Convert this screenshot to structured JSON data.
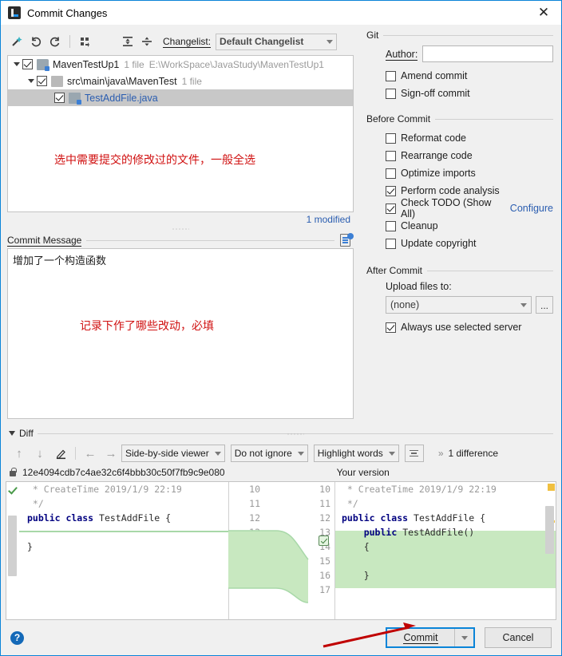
{
  "window": {
    "title": "Commit Changes",
    "icon": "intellij-idea-icon",
    "close_label": "✕"
  },
  "toolbar": {
    "icons": [
      "magic-wand-icon",
      "revert-icon",
      "refresh-icon",
      "group-by-icon",
      "expand-all-icon",
      "collapse-all-icon"
    ],
    "changelist_label": "Changelist:",
    "changelist_value": "Default Changelist"
  },
  "tree": {
    "nodes": [
      {
        "name": "MavenTestUp1",
        "files": "1 file",
        "path": "E:\\WorkSpace\\JavaStudy\\MavenTestUp1",
        "checked": true,
        "icon": "module-icon"
      },
      {
        "name": "src\\main\\java\\MavenTest",
        "files": "1 file",
        "path": "",
        "checked": true,
        "icon": "folder-icon"
      },
      {
        "name": "TestAddFile.java",
        "files": "",
        "path": "",
        "checked": true,
        "icon": "java-file-icon"
      }
    ],
    "annotation": "选中需要提交的修改过的文件，一般全选",
    "status": "1 modified"
  },
  "commit_message": {
    "label": "Commit Message",
    "value": "增加了一个构造函数",
    "annotation": "记录下作了哪些改动，必填",
    "toolbar_icon": "commit-history-icon"
  },
  "git": {
    "title": "Git",
    "author_label": "Author:",
    "author_value": "",
    "options": [
      {
        "label": "Amend commit",
        "checked": false
      },
      {
        "label": "Sign-off commit",
        "checked": false
      }
    ]
  },
  "before_commit": {
    "title": "Before Commit",
    "options": [
      {
        "label": "Reformat code",
        "checked": false
      },
      {
        "label": "Rearrange code",
        "checked": false
      },
      {
        "label": "Optimize imports",
        "checked": false
      },
      {
        "label": "Perform code analysis",
        "checked": true
      },
      {
        "label": "Check TODO (Show All)",
        "checked": true,
        "link": "Configure"
      },
      {
        "label": "Cleanup",
        "checked": false
      },
      {
        "label": "Update copyright",
        "checked": false
      }
    ]
  },
  "after_commit": {
    "title": "After Commit",
    "upload_label": "Upload files to:",
    "upload_value": "(none)",
    "browse_label": "...",
    "always_label": "Always use selected server",
    "always_checked": true
  },
  "diff": {
    "title": "Diff",
    "toolbar": {
      "prev_icon": "arrow-up-icon",
      "next_icon": "arrow-down-icon",
      "edit_icon": "pencil-icon",
      "left_icon": "arrow-left-icon",
      "right_icon": "arrow-right-icon",
      "viewer_mode": "Side-by-side viewer",
      "ignore_mode": "Do not ignore",
      "highlight_mode": "Highlight words",
      "collapse_icon": "collapse-unchanged-icon",
      "more_icon": "»",
      "difference_count": "1 difference"
    },
    "left_header": {
      "icon": "lock-icon",
      "revision": "12e4094cdb7c4ae32c6f4bbb30c50f7fb9c9e080"
    },
    "right_header": "Your version",
    "left_lines": [
      {
        "num": "10",
        "text": " * CreateTime 2019/1/9 22:19",
        "kind": "comment"
      },
      {
        "num": "11",
        "text": " */",
        "kind": "comment"
      },
      {
        "num": "12",
        "text": "public class TestAddFile {",
        "kind": "code"
      },
      {
        "num": "13",
        "text": "",
        "kind": "blank"
      },
      {
        "num": "14",
        "text": "}",
        "kind": "code"
      },
      {
        "num": "15",
        "text": "",
        "kind": "blank"
      }
    ],
    "right_lines": [
      {
        "num": "10",
        "text": " * CreateTime 2019/1/9 22:19",
        "kind": "comment",
        "added": false
      },
      {
        "num": "11",
        "text": " */",
        "kind": "comment",
        "added": false
      },
      {
        "num": "12",
        "text": "public class TestAddFile {",
        "kind": "code",
        "added": false
      },
      {
        "num": "13",
        "text": "    public TestAddFile()",
        "kind": "code",
        "added": true
      },
      {
        "num": "14",
        "text": "    {",
        "kind": "code",
        "added": true
      },
      {
        "num": "15",
        "text": "",
        "kind": "blank",
        "added": true
      },
      {
        "num": "16",
        "text": "    }",
        "kind": "code",
        "added": true
      },
      {
        "num": "17",
        "text": "",
        "kind": "blank",
        "added": false
      }
    ]
  },
  "footer": {
    "help_label": "?",
    "commit_label": "Commit",
    "commit_dropdown_icon": "chevron-down-icon",
    "cancel_label": "Cancel"
  },
  "colors": {
    "accent": "#0a84d8",
    "annotation_red": "#d01010",
    "link_blue": "#2a5db0",
    "diff_added": "#c8e8c0"
  }
}
